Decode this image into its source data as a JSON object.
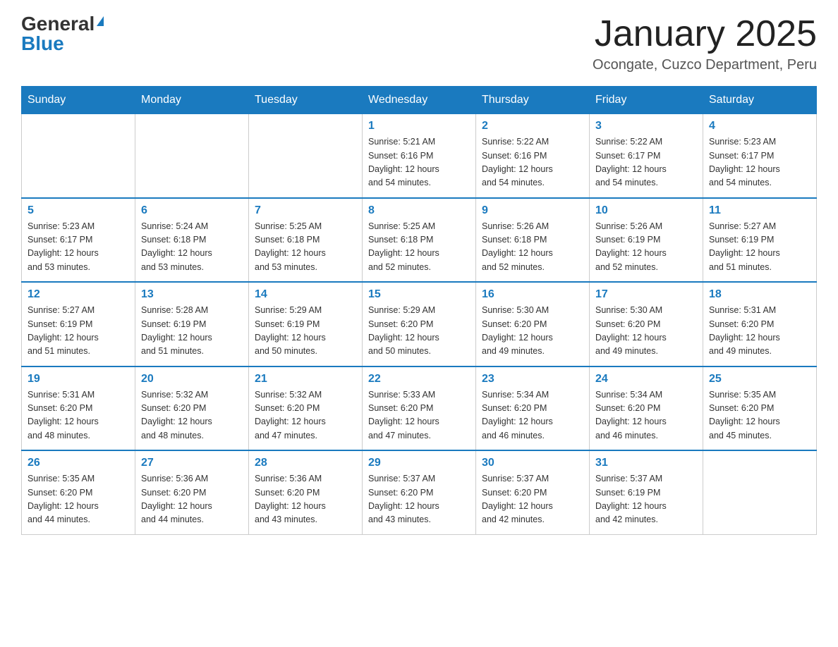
{
  "header": {
    "logo": {
      "general": "General",
      "blue": "Blue",
      "triangle": "▶"
    },
    "title": "January 2025",
    "location": "Ocongate, Cuzco Department, Peru"
  },
  "days_of_week": [
    "Sunday",
    "Monday",
    "Tuesday",
    "Wednesday",
    "Thursday",
    "Friday",
    "Saturday"
  ],
  "weeks": [
    {
      "days": [
        {
          "number": "",
          "info": ""
        },
        {
          "number": "",
          "info": ""
        },
        {
          "number": "",
          "info": ""
        },
        {
          "number": "1",
          "info": "Sunrise: 5:21 AM\nSunset: 6:16 PM\nDaylight: 12 hours\nand 54 minutes."
        },
        {
          "number": "2",
          "info": "Sunrise: 5:22 AM\nSunset: 6:16 PM\nDaylight: 12 hours\nand 54 minutes."
        },
        {
          "number": "3",
          "info": "Sunrise: 5:22 AM\nSunset: 6:17 PM\nDaylight: 12 hours\nand 54 minutes."
        },
        {
          "number": "4",
          "info": "Sunrise: 5:23 AM\nSunset: 6:17 PM\nDaylight: 12 hours\nand 54 minutes."
        }
      ]
    },
    {
      "days": [
        {
          "number": "5",
          "info": "Sunrise: 5:23 AM\nSunset: 6:17 PM\nDaylight: 12 hours\nand 53 minutes."
        },
        {
          "number": "6",
          "info": "Sunrise: 5:24 AM\nSunset: 6:18 PM\nDaylight: 12 hours\nand 53 minutes."
        },
        {
          "number": "7",
          "info": "Sunrise: 5:25 AM\nSunset: 6:18 PM\nDaylight: 12 hours\nand 53 minutes."
        },
        {
          "number": "8",
          "info": "Sunrise: 5:25 AM\nSunset: 6:18 PM\nDaylight: 12 hours\nand 52 minutes."
        },
        {
          "number": "9",
          "info": "Sunrise: 5:26 AM\nSunset: 6:18 PM\nDaylight: 12 hours\nand 52 minutes."
        },
        {
          "number": "10",
          "info": "Sunrise: 5:26 AM\nSunset: 6:19 PM\nDaylight: 12 hours\nand 52 minutes."
        },
        {
          "number": "11",
          "info": "Sunrise: 5:27 AM\nSunset: 6:19 PM\nDaylight: 12 hours\nand 51 minutes."
        }
      ]
    },
    {
      "days": [
        {
          "number": "12",
          "info": "Sunrise: 5:27 AM\nSunset: 6:19 PM\nDaylight: 12 hours\nand 51 minutes."
        },
        {
          "number": "13",
          "info": "Sunrise: 5:28 AM\nSunset: 6:19 PM\nDaylight: 12 hours\nand 51 minutes."
        },
        {
          "number": "14",
          "info": "Sunrise: 5:29 AM\nSunset: 6:19 PM\nDaylight: 12 hours\nand 50 minutes."
        },
        {
          "number": "15",
          "info": "Sunrise: 5:29 AM\nSunset: 6:20 PM\nDaylight: 12 hours\nand 50 minutes."
        },
        {
          "number": "16",
          "info": "Sunrise: 5:30 AM\nSunset: 6:20 PM\nDaylight: 12 hours\nand 49 minutes."
        },
        {
          "number": "17",
          "info": "Sunrise: 5:30 AM\nSunset: 6:20 PM\nDaylight: 12 hours\nand 49 minutes."
        },
        {
          "number": "18",
          "info": "Sunrise: 5:31 AM\nSunset: 6:20 PM\nDaylight: 12 hours\nand 49 minutes."
        }
      ]
    },
    {
      "days": [
        {
          "number": "19",
          "info": "Sunrise: 5:31 AM\nSunset: 6:20 PM\nDaylight: 12 hours\nand 48 minutes."
        },
        {
          "number": "20",
          "info": "Sunrise: 5:32 AM\nSunset: 6:20 PM\nDaylight: 12 hours\nand 48 minutes."
        },
        {
          "number": "21",
          "info": "Sunrise: 5:32 AM\nSunset: 6:20 PM\nDaylight: 12 hours\nand 47 minutes."
        },
        {
          "number": "22",
          "info": "Sunrise: 5:33 AM\nSunset: 6:20 PM\nDaylight: 12 hours\nand 47 minutes."
        },
        {
          "number": "23",
          "info": "Sunrise: 5:34 AM\nSunset: 6:20 PM\nDaylight: 12 hours\nand 46 minutes."
        },
        {
          "number": "24",
          "info": "Sunrise: 5:34 AM\nSunset: 6:20 PM\nDaylight: 12 hours\nand 46 minutes."
        },
        {
          "number": "25",
          "info": "Sunrise: 5:35 AM\nSunset: 6:20 PM\nDaylight: 12 hours\nand 45 minutes."
        }
      ]
    },
    {
      "days": [
        {
          "number": "26",
          "info": "Sunrise: 5:35 AM\nSunset: 6:20 PM\nDaylight: 12 hours\nand 44 minutes."
        },
        {
          "number": "27",
          "info": "Sunrise: 5:36 AM\nSunset: 6:20 PM\nDaylight: 12 hours\nand 44 minutes."
        },
        {
          "number": "28",
          "info": "Sunrise: 5:36 AM\nSunset: 6:20 PM\nDaylight: 12 hours\nand 43 minutes."
        },
        {
          "number": "29",
          "info": "Sunrise: 5:37 AM\nSunset: 6:20 PM\nDaylight: 12 hours\nand 43 minutes."
        },
        {
          "number": "30",
          "info": "Sunrise: 5:37 AM\nSunset: 6:20 PM\nDaylight: 12 hours\nand 42 minutes."
        },
        {
          "number": "31",
          "info": "Sunrise: 5:37 AM\nSunset: 6:19 PM\nDaylight: 12 hours\nand 42 minutes."
        },
        {
          "number": "",
          "info": ""
        }
      ]
    }
  ]
}
